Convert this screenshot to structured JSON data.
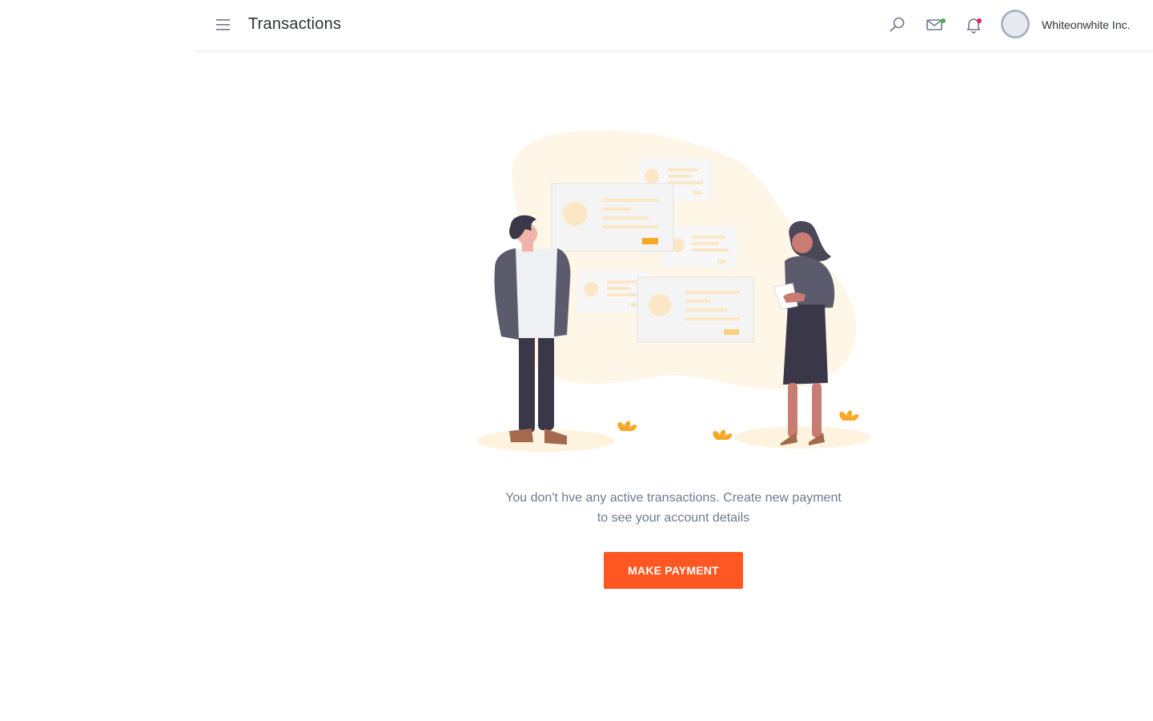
{
  "header": {
    "title": "Transactions",
    "company_name": "Whiteonwhite Inc."
  },
  "icons": {
    "menu": "hamburger-menu-icon",
    "search": "search-icon",
    "mail": "mail-icon",
    "notifications": "bell-icon"
  },
  "badges": {
    "mail_dot_color": "#4caf50",
    "notification_dot_color": "#e91e63"
  },
  "empty_state": {
    "message_line1": "You don't hve any active transactions. Create new payment",
    "message_line2": "to see your account details",
    "button_label": "MAKE PAYMENT"
  },
  "colors": {
    "accent": "#ff5722",
    "muted_text": "#6e7a8f",
    "illustration_warm": "#fef6e6",
    "illustration_orange": "#f9a825"
  }
}
